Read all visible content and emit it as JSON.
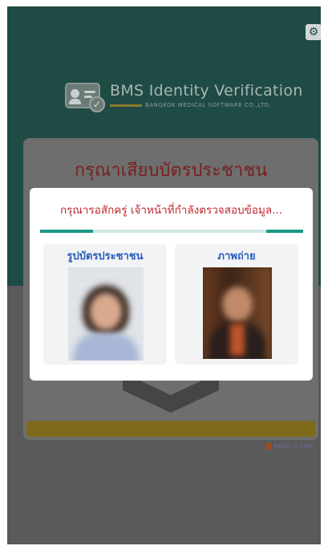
{
  "header": {
    "settings_icon": "gear-icon",
    "logo": {
      "title": "BMS Identity Verification",
      "subtitle": "BANGKOK MEDICAL SOFTWARE CO.,LTD."
    }
  },
  "background_card": {
    "title": "กรุณาเสียบบัตรประชาชน"
  },
  "modal": {
    "message": "กรุณารอสักครู่ เจ้าหน้าที่กำลังตรวจสอบข้อมูล...",
    "progress": 0.2,
    "photos": [
      {
        "label": "รูปบัตรประชาชน"
      },
      {
        "label": "ภาพถ่าย"
      }
    ]
  },
  "footer": {
    "brand": "Rabbit is Care"
  },
  "colors": {
    "header_bg": "#1f4b45",
    "overlay_bg": "#5a5a5a",
    "error_text": "#c0262c",
    "accent": "#1a9a86",
    "label_blue": "#2a5bb8"
  }
}
